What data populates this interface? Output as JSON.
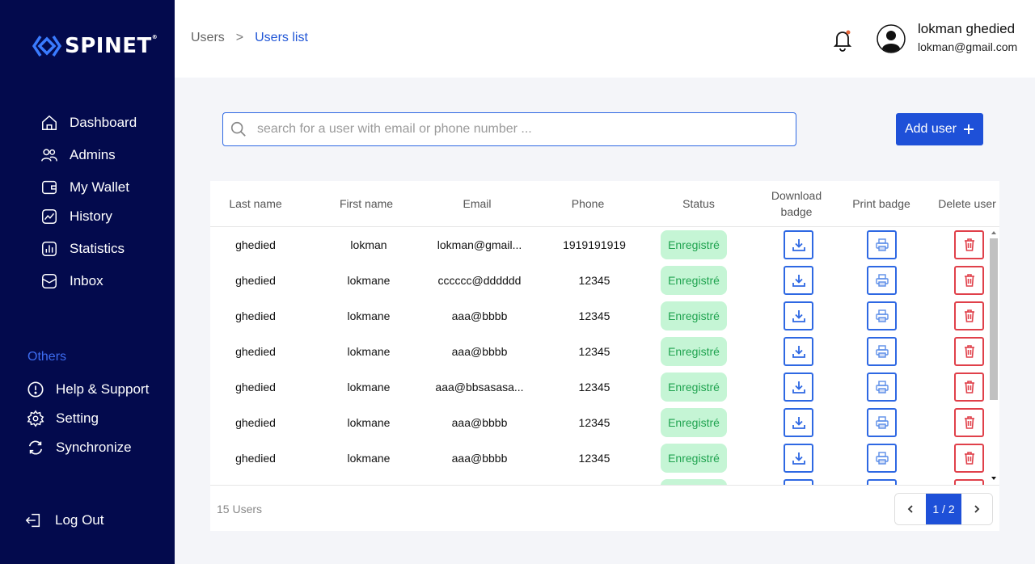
{
  "app": {
    "brand": "SPINET",
    "trademark": "®"
  },
  "sidebar": {
    "items": [
      {
        "label": "Dashboard",
        "icon": "home-icon"
      },
      {
        "label": "Admins",
        "icon": "users-icon"
      },
      {
        "label": "My Wallet",
        "icon": "wallet-icon"
      },
      {
        "label": "History",
        "icon": "history-icon"
      },
      {
        "label": "Statistics",
        "icon": "statistics-icon"
      },
      {
        "label": "Inbox",
        "icon": "inbox-icon"
      }
    ],
    "others_label": "Others",
    "others": [
      {
        "label": "Help & Support",
        "icon": "help-icon"
      },
      {
        "label": "Setting",
        "icon": "gear-icon"
      },
      {
        "label": "Synchronize",
        "icon": "sync-icon"
      }
    ],
    "logout_label": "Log Out"
  },
  "header": {
    "breadcrumb_root": "Users",
    "breadcrumb_sep": ">",
    "breadcrumb_current": "Users list",
    "user_name": "lokman ghedied",
    "user_email": "lokman@gmail.com"
  },
  "search": {
    "placeholder": "search for a user with email or phone number ...",
    "value": ""
  },
  "add_user_label": "Add user",
  "table": {
    "headers": {
      "last_name": "Last name",
      "first_name": "First name",
      "email": "Email",
      "phone": "Phone",
      "status": "Status",
      "download_1": "Download",
      "download_2": "badge",
      "print": "Print badge",
      "delete": "Delete user"
    },
    "rows": [
      {
        "last": "ghedied",
        "first": "lokman",
        "email": "lokman@gmail...",
        "phone": "1919191919",
        "status": "Enregistré"
      },
      {
        "last": "ghedied",
        "first": "lokmane",
        "email": "cccccc@dddddd",
        "phone": "12345",
        "status": "Enregistré"
      },
      {
        "last": "ghedied",
        "first": "lokmane",
        "email": "aaa@bbbb",
        "phone": "12345",
        "status": "Enregistré"
      },
      {
        "last": "ghedied",
        "first": "lokmane",
        "email": "aaa@bbbb",
        "phone": "12345",
        "status": "Enregistré"
      },
      {
        "last": "ghedied",
        "first": "lokmane",
        "email": "aaa@bbsasasa...",
        "phone": "12345",
        "status": "Enregistré"
      },
      {
        "last": "ghedied",
        "first": "lokmane",
        "email": "aaa@bbbb",
        "phone": "12345",
        "status": "Enregistré"
      },
      {
        "last": "ghedied",
        "first": "lokmane",
        "email": "aaa@bbbb",
        "phone": "12345",
        "status": "Enregistré"
      },
      {
        "last": "",
        "first": "",
        "email": "",
        "phone": "",
        "status": ""
      }
    ],
    "footer_count": "15 Users",
    "pagination": "1 / 2"
  },
  "colors": {
    "sidebar_bg": "#030a4d",
    "accent": "#1e50d8",
    "status_bg": "#c5f5d5",
    "status_text": "#1fa34f",
    "delete": "#e0404a"
  }
}
